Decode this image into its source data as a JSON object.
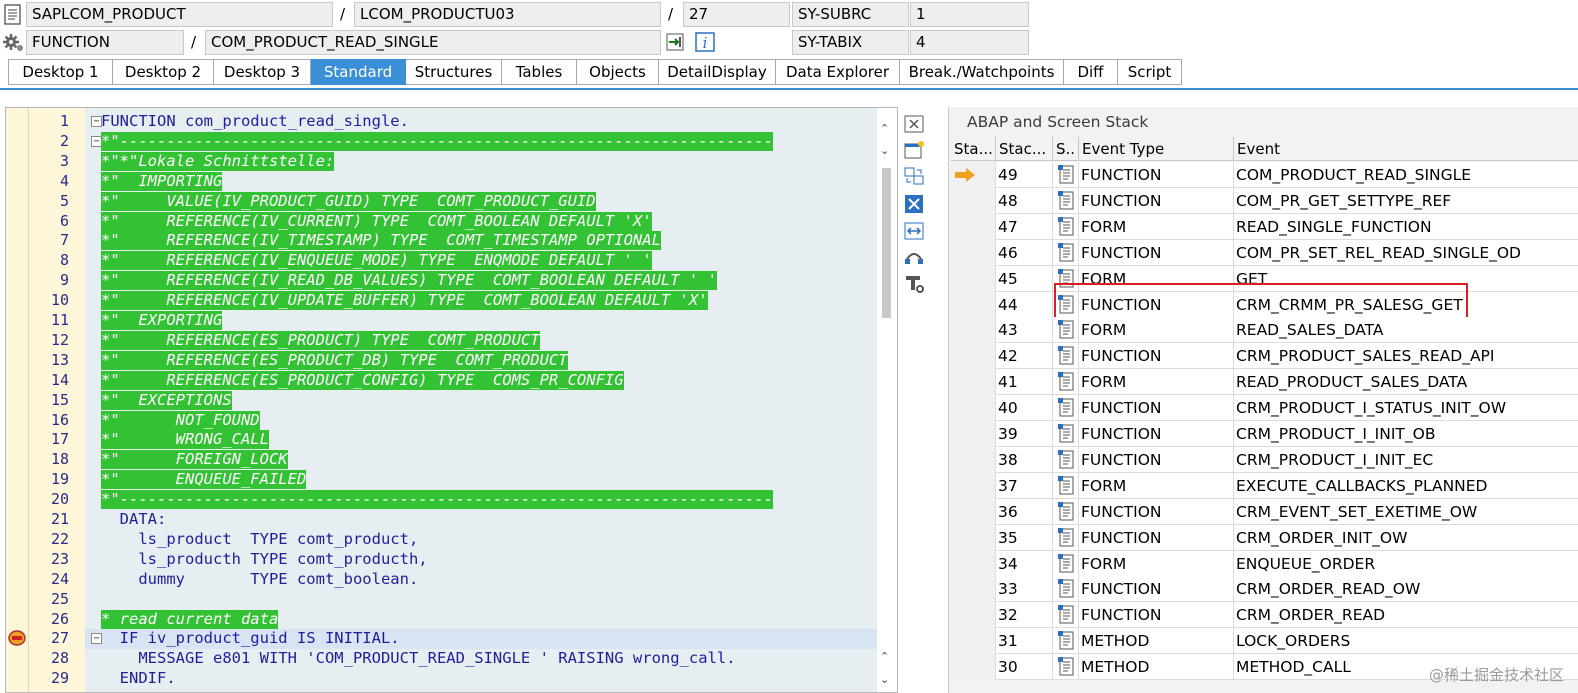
{
  "header": {
    "program": "SAPLCOM_PRODUCT",
    "include": "LCOM_PRODUCTU03",
    "line": "27",
    "subrc_label": "SY-SUBRC",
    "subrc_value": "1",
    "event_type": "FUNCTION",
    "event_name": "COM_PRODUCT_READ_SINGLE",
    "tabix_label": "SY-TABIX",
    "tabix_value": "4",
    "separator": "/"
  },
  "tabs": [
    {
      "label": "Desktop 1",
      "active": false
    },
    {
      "label": "Desktop 2",
      "active": false
    },
    {
      "label": "Desktop 3",
      "active": false
    },
    {
      "label": "Standard",
      "active": true
    },
    {
      "label": "Structures",
      "active": false
    },
    {
      "label": "Tables",
      "active": false
    },
    {
      "label": "Objects",
      "active": false
    },
    {
      "label": "DetailDisplay",
      "active": false
    },
    {
      "label": "Data Explorer",
      "active": false
    },
    {
      "label": "Break./Watchpoints",
      "active": false
    },
    {
      "label": "Diff",
      "active": false
    },
    {
      "label": "Script",
      "active": false
    }
  ],
  "editor": {
    "lines": [
      {
        "n": "1",
        "text": "FUNCTION com_product_read_single.",
        "kind": "func",
        "fold": "-"
      },
      {
        "n": "2",
        "text": "*\"----------------------------------------------------------------------",
        "kind": "cmt",
        "fold": "-"
      },
      {
        "n": "3",
        "text": "*\"*\"Lokale Schnittstelle:",
        "kind": "cmt"
      },
      {
        "n": "4",
        "text": "*\"  IMPORTING",
        "kind": "cmt"
      },
      {
        "n": "5",
        "text": "*\"     VALUE(IV_PRODUCT_GUID) TYPE  COMT_PRODUCT_GUID",
        "kind": "cmt"
      },
      {
        "n": "6",
        "text": "*\"     REFERENCE(IV_CURRENT) TYPE  COMT_BOOLEAN DEFAULT 'X'",
        "kind": "cmt"
      },
      {
        "n": "7",
        "text": "*\"     REFERENCE(IV_TIMESTAMP) TYPE  COMT_TIMESTAMP OPTIONAL",
        "kind": "cmt"
      },
      {
        "n": "8",
        "text": "*\"     REFERENCE(IV_ENQUEUE_MODE) TYPE  ENQMODE DEFAULT ' '",
        "kind": "cmt"
      },
      {
        "n": "9",
        "text": "*\"     REFERENCE(IV_READ_DB_VALUES) TYPE  COMT_BOOLEAN DEFAULT ' '",
        "kind": "cmt"
      },
      {
        "n": "10",
        "text": "*\"     REFERENCE(IV_UPDATE_BUFFER) TYPE  COMT_BOOLEAN DEFAULT 'X'",
        "kind": "cmt"
      },
      {
        "n": "11",
        "text": "*\"  EXPORTING",
        "kind": "cmt"
      },
      {
        "n": "12",
        "text": "*\"     REFERENCE(ES_PRODUCT) TYPE  COMT_PRODUCT",
        "kind": "cmt"
      },
      {
        "n": "13",
        "text": "*\"     REFERENCE(ES_PRODUCT_DB) TYPE  COMT_PRODUCT",
        "kind": "cmt"
      },
      {
        "n": "14",
        "text": "*\"     REFERENCE(ES_PRODUCT_CONFIG) TYPE  COMS_PR_CONFIG",
        "kind": "cmt"
      },
      {
        "n": "15",
        "text": "*\"  EXCEPTIONS",
        "kind": "cmt"
      },
      {
        "n": "16",
        "text": "*\"      NOT_FOUND",
        "kind": "cmt"
      },
      {
        "n": "17",
        "text": "*\"      WRONG_CALL",
        "kind": "cmt"
      },
      {
        "n": "18",
        "text": "*\"      FOREIGN_LOCK",
        "kind": "cmt"
      },
      {
        "n": "19",
        "text": "*\"      ENQUEUE_FAILED",
        "kind": "cmt"
      },
      {
        "n": "20",
        "text": "*\"----------------------------------------------------------------------",
        "kind": "cmt"
      },
      {
        "n": "21",
        "text": "  DATA:",
        "kind": "data"
      },
      {
        "n": "22",
        "text": "    ls_product  TYPE comt_product,",
        "kind": "decl"
      },
      {
        "n": "23",
        "text": "    ls_producth TYPE comt_producth,",
        "kind": "decl"
      },
      {
        "n": "24",
        "text": "    dummy       TYPE comt_boolean.",
        "kind": "decl"
      },
      {
        "n": "25",
        "text": "",
        "kind": "blank"
      },
      {
        "n": "26",
        "text": "* read current data",
        "kind": "cmt"
      },
      {
        "n": "27",
        "text": "  IF iv_product_guid IS INITIAL.",
        "kind": "if",
        "fold": "-",
        "current": true
      },
      {
        "n": "28",
        "text": "    MESSAGE e801 WITH 'COM_PRODUCT_READ_SINGLE ' RAISING wrong_call.",
        "kind": "msg"
      },
      {
        "n": "29",
        "text": "  ENDIF.",
        "kind": "endif"
      }
    ]
  },
  "stack": {
    "title": "ABAP and Screen Stack",
    "columns": [
      "Sta...",
      "Stac...",
      "S..",
      "Event Type",
      "Event"
    ],
    "rows": [
      {
        "level": "49",
        "type": "FUNCTION",
        "event": "COM_PRODUCT_READ_SINGLE",
        "current": true
      },
      {
        "level": "48",
        "type": "FUNCTION",
        "event": "COM_PR_GET_SETTYPE_REF"
      },
      {
        "level": "47",
        "type": "FORM",
        "event": "READ_SINGLE_FUNCTION"
      },
      {
        "level": "46",
        "type": "FUNCTION",
        "event": "COM_PR_SET_REL_READ_SINGLE_OD"
      },
      {
        "level": "45",
        "type": "FORM",
        "event": "GET"
      },
      {
        "level": "44",
        "type": "FUNCTION",
        "event": "CRM_CRMM_PR_SALESG_GET",
        "highlighted": true
      },
      {
        "level": "43",
        "type": "FORM",
        "event": "READ_SALES_DATA"
      },
      {
        "level": "42",
        "type": "FUNCTION",
        "event": "CRM_PRODUCT_SALES_READ_API"
      },
      {
        "level": "41",
        "type": "FORM",
        "event": "READ_PRODUCT_SALES_DATA"
      },
      {
        "level": "40",
        "type": "FUNCTION",
        "event": "CRM_PRODUCT_I_STATUS_INIT_OW"
      },
      {
        "level": "39",
        "type": "FUNCTION",
        "event": "CRM_PRODUCT_I_INIT_OB"
      },
      {
        "level": "38",
        "type": "FUNCTION",
        "event": "CRM_PRODUCT_I_INIT_EC"
      },
      {
        "level": "37",
        "type": "FORM",
        "event": "EXECUTE_CALLBACKS_PLANNED"
      },
      {
        "level": "36",
        "type": "FUNCTION",
        "event": "CRM_EVENT_SET_EXETIME_OW"
      },
      {
        "level": "35",
        "type": "FUNCTION",
        "event": "CRM_ORDER_INIT_OW"
      },
      {
        "level": "34",
        "type": "FORM",
        "event": "ENQUEUE_ORDER"
      },
      {
        "level": "33",
        "type": "FUNCTION",
        "event": "CRM_ORDER_READ_OW"
      },
      {
        "level": "32",
        "type": "FUNCTION",
        "event": "CRM_ORDER_READ"
      },
      {
        "level": "31",
        "type": "METHOD",
        "event": "LOCK_ORDERS"
      },
      {
        "level": "30",
        "type": "METHOD",
        "event": "METHOD_CALL"
      }
    ]
  },
  "watermark": "@稀土掘金技术社区",
  "colors": {
    "accent": "#3a8fd6",
    "comment_bg": "#33c233",
    "highlight_box": "#d81e1e",
    "current_arrow": "#f0a020"
  },
  "icons": [
    "document-icon",
    "gear-icon",
    "enter-icon",
    "info-icon",
    "close-panel-icon",
    "new-window-icon",
    "swap-icon",
    "maximize-icon",
    "fit-width-icon",
    "network-icon",
    "tools-icon",
    "current-line-arrow-icon",
    "breakpoint-marker-icon",
    "scroll-up-icon",
    "scroll-down-icon"
  ]
}
